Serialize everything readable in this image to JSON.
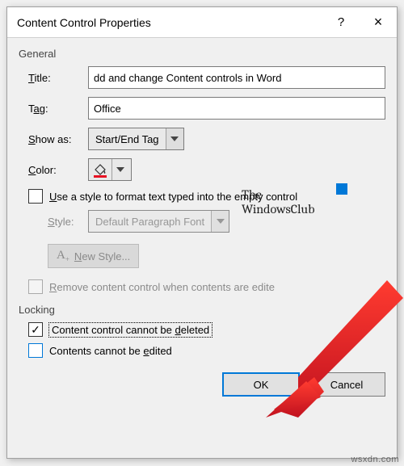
{
  "window": {
    "title": "Content Control Properties",
    "help_tooltip": "?",
    "close_tooltip": "×"
  },
  "general": {
    "section": "General",
    "title_label": "Title:",
    "title_value": "dd and change Content controls in Word",
    "tag_label": "Tag:",
    "tag_value": "Office",
    "showas_label": "Show as:",
    "showas_value": "Start/End Tag",
    "color_label": "Color:",
    "use_style_label": "Use a style to format text typed into the empty control",
    "style_label": "Style:",
    "style_value": "Default Paragraph Font",
    "new_style_label": "New Style...",
    "remove_label": "Remove content control when contents are edite"
  },
  "locking": {
    "section": "Locking",
    "cannot_delete_label": "Content control cannot be deleted",
    "cannot_delete_checked": true,
    "cannot_edit_label": "Contents cannot be edited",
    "cannot_edit_checked": false
  },
  "footer": {
    "ok": "OK",
    "cancel": "Cancel"
  },
  "watermark": {
    "line1": "The",
    "line2": "WindowsClub"
  }
}
